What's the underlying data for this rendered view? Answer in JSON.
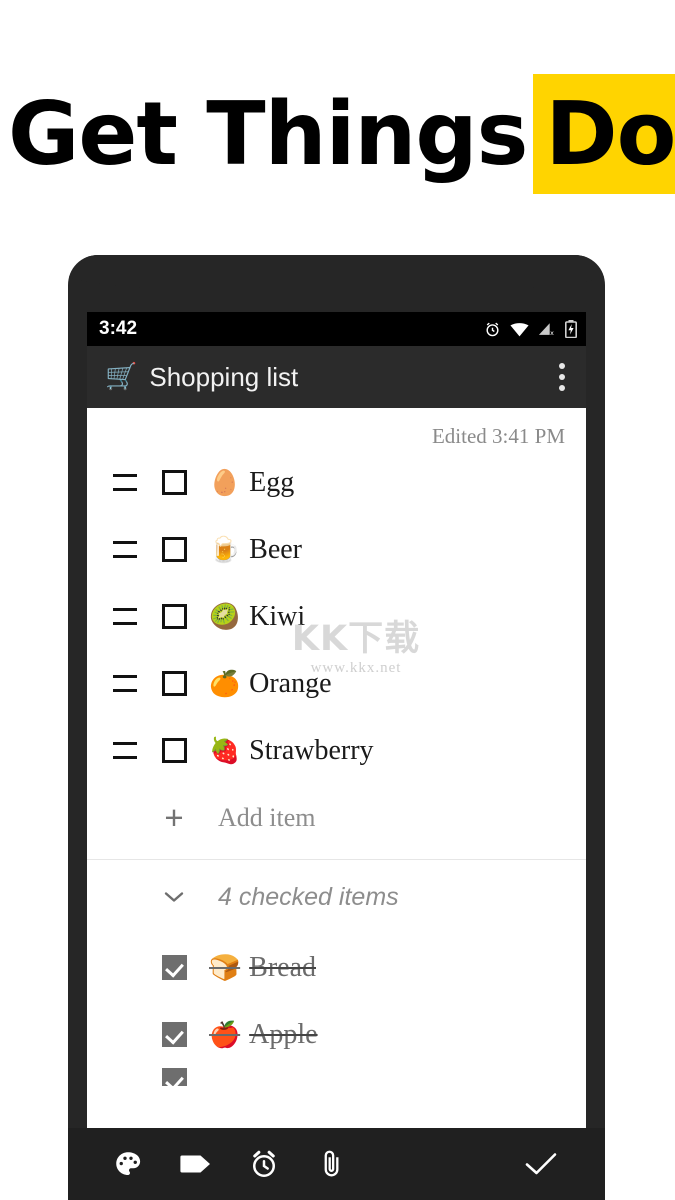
{
  "headline": {
    "plain": "Get Things",
    "highlight": "Done",
    "highlight_color": "#FFD400"
  },
  "phone": {
    "statusbar": {
      "time": "3:42",
      "icons": [
        "alarm-icon",
        "wifi-icon",
        "signal-no-service-icon",
        "battery-charging-icon"
      ]
    },
    "appbar": {
      "emoji": "🛒",
      "title": "Shopping list",
      "overflow_label": "overflow-menu"
    },
    "note": {
      "edited": "Edited 3:41 PM",
      "items": [
        {
          "emoji": "🥚",
          "text": "Egg",
          "checked": false
        },
        {
          "emoji": "🍺",
          "text": "Beer",
          "checked": false
        },
        {
          "emoji": "🥝",
          "text": "Kiwi",
          "checked": false
        },
        {
          "emoji": "🍊",
          "text": "Orange",
          "checked": false
        },
        {
          "emoji": "🍓",
          "text": "Strawberry",
          "checked": false
        }
      ],
      "add_item_label": "Add item",
      "add_item_plus": "+",
      "checked_section_label": "4 checked items",
      "checked_items": [
        {
          "emoji": "🍞",
          "text": "Bread",
          "checked": true
        },
        {
          "emoji": "🍎",
          "text": "Apple",
          "checked": true
        }
      ]
    },
    "bottombar": {
      "tools": [
        "palette-icon",
        "tag-icon",
        "alarm-clock-icon",
        "paperclip-icon"
      ],
      "confirm": "check-icon"
    }
  },
  "watermark": {
    "cn": "KK下载",
    "url": "www.kkx.net"
  }
}
